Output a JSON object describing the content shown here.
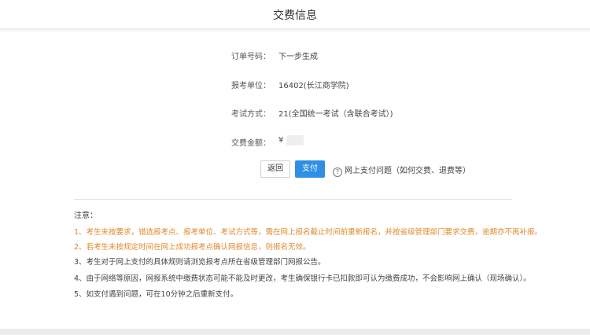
{
  "header": {
    "title": "交费信息"
  },
  "fields": [
    {
      "label": "订单号码：",
      "value": "下一步生成"
    },
    {
      "label": "报考单位：",
      "value": "16402(长江商学院)"
    },
    {
      "label": "考试方式：",
      "value": "21(全国统一考试（含联合考试）)"
    },
    {
      "label": "交费金额：",
      "value": "¥"
    }
  ],
  "buttons": {
    "back_label": "返回",
    "pay_label": "支付"
  },
  "help": {
    "icon": "question-circle-icon",
    "text": "网上支付问题（如何交费、退费等）"
  },
  "notice": {
    "title": "注意：",
    "items": [
      "1、考生未按要求，错选报考点、报考单位、考试方式等，需在网上报名截止时间前重新报名，并按省级管理部门要求交费，逾期亦不再补报。",
      "2、若考生未按规定时间在网上成功报考点确认网报信息，则报名无效。",
      "3、考生对于网上支付的具体规则请浏览报考点所在省级管理部门网报公告。",
      "4、由于网络等原因，网报系统中缴费状态可能不能及时更改，考生确保银行卡已扣款即可认为缴费成功，不会影响网上确认（现场确认）。",
      "5、如支付遇到问题，可在10分钟之后重新支付。"
    ]
  },
  "colors": {
    "accent": "#2e8fe5",
    "warning": "#e08a2c"
  }
}
